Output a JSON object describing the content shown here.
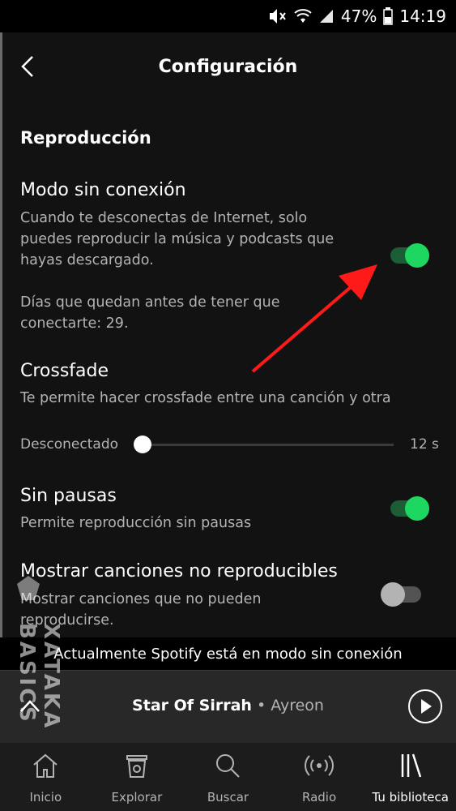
{
  "status": {
    "battery": "47%",
    "time": "14:19"
  },
  "header": {
    "title": "Configuración"
  },
  "section": {
    "title": "Reproducción"
  },
  "offline_mode": {
    "title": "Modo sin conexión",
    "desc_line1": "Cuando te desconectas de Internet, solo",
    "desc_line2": "puedes reproducir la música y podcasts que",
    "desc_line3": "hayas descargado.",
    "days_line1": "Días que quedan antes de tener que",
    "days_line2": "conectarte: 29.",
    "enabled": true
  },
  "crossfade": {
    "title": "Crossfade",
    "desc": "Te permite hacer crossfade entre una canción y otra",
    "min_label": "Desconectado",
    "max_label": "12 s",
    "value": 0
  },
  "gapless": {
    "title": "Sin pausas",
    "desc": "Permite reproducción sin pausas",
    "enabled": true
  },
  "unplayable": {
    "title": "Mostrar canciones no reproducibles",
    "desc_line1": "Mostrar canciones que no pueden",
    "desc_line2": "reproducirse.",
    "enabled": false
  },
  "banner": {
    "text": "Actualmente Spotify está en modo sin conexión"
  },
  "player": {
    "song": "Star Of Sirrah",
    "separator": "•",
    "artist": "Ayreon"
  },
  "nav": {
    "items": [
      {
        "label": "Inicio",
        "icon": "home-icon"
      },
      {
        "label": "Explorar",
        "icon": "browse-icon"
      },
      {
        "label": "Buscar",
        "icon": "search-icon"
      },
      {
        "label": "Radio",
        "icon": "radio-icon"
      },
      {
        "label": "Tu biblioteca",
        "icon": "library-icon",
        "active": true
      }
    ]
  },
  "watermark": {
    "text": "XATAKA BASICS"
  },
  "colors": {
    "accent": "#1ed760",
    "background": "#121212",
    "annotation_arrow": "#ff1a1a"
  }
}
